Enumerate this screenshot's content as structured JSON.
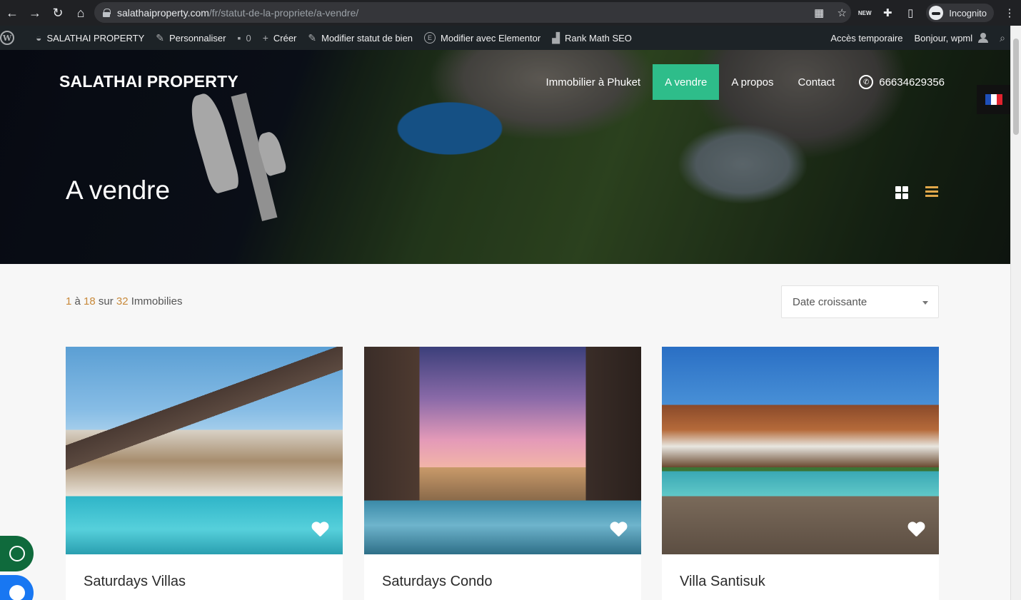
{
  "browser": {
    "url_domain": "salathaiproperty.com",
    "url_path": "/fr/statut-de-la-propriete/a-vendre/",
    "profile_label": "Incognito",
    "icons": [
      "back-arrow-icon",
      "forward-arrow-icon",
      "reload-icon",
      "home-icon",
      "lock-icon",
      "qr-code-icon",
      "star-icon",
      "new-extension-icon",
      "puzzle-icon",
      "side-panel-icon",
      "incognito-icon",
      "kebab-menu-icon"
    ]
  },
  "admin_bar": {
    "site_name": "SALATHAI PROPERTY",
    "customize": "Personnaliser",
    "comments_count": "0",
    "create": "Créer",
    "edit_status": "Modifier statut de bien",
    "elementor": "Modifier avec Elementor",
    "rank_math": "Rank Math SEO",
    "temp_access": "Accès temporaire",
    "greeting": "Bonjour, wpml"
  },
  "site": {
    "logo": "SALATHAI PROPERTY",
    "nav": [
      {
        "label": "Immobilier à Phuket",
        "active": false
      },
      {
        "label": "A vendre",
        "active": true
      },
      {
        "label": "A propos",
        "active": false
      },
      {
        "label": "Contact",
        "active": false
      }
    ],
    "phone": "66634629356",
    "accent_color": "#2ebd8a",
    "highlight_color": "#c8893a"
  },
  "hero": {
    "title": "A vendre"
  },
  "listing": {
    "range_start": "1",
    "range_sep": "à",
    "range_end": "18",
    "of_word": "sur",
    "total": "32",
    "noun": "Immobilies",
    "sort_selected": "Date croissante"
  },
  "properties": [
    {
      "title": "Saturdays Villas"
    },
    {
      "title": "Saturdays Condo"
    },
    {
      "title": "Villa Santisuk"
    }
  ]
}
